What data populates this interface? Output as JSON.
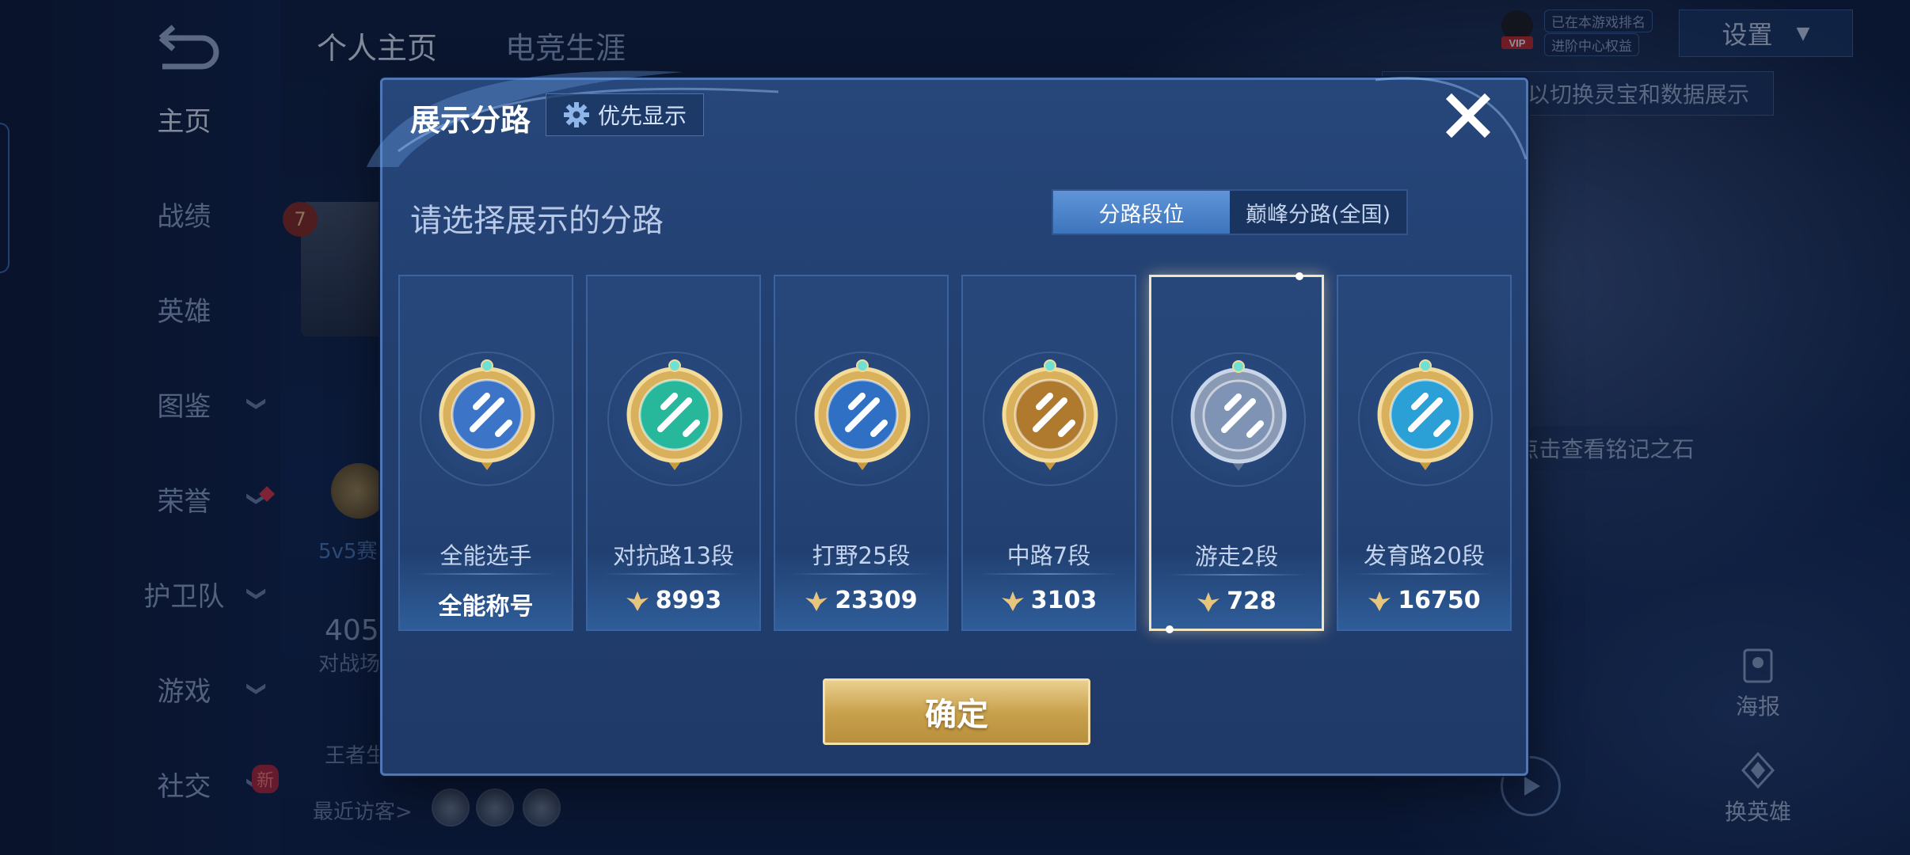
{
  "background": {
    "top_tabs": [
      "个人主页",
      "电竞生涯"
    ],
    "nav_items": [
      {
        "label": "主页",
        "has_chevron": false,
        "active": true
      },
      {
        "label": "战绩",
        "has_chevron": false,
        "active": false
      },
      {
        "label": "英雄",
        "has_chevron": false,
        "active": false
      },
      {
        "label": "图鉴",
        "has_chevron": true,
        "active": false
      },
      {
        "label": "荣誉",
        "has_chevron": true,
        "active": false
      },
      {
        "label": "护卫队",
        "has_chevron": true,
        "active": false
      },
      {
        "label": "游戏",
        "has_chevron": true,
        "active": false
      },
      {
        "label": "社交",
        "has_chevron": true,
        "active": false
      }
    ],
    "new_badge": "新",
    "vip_label": "VIP",
    "vip_tags": [
      "已在本游戏排名",
      "进阶中心权益"
    ],
    "settings_label": "设置",
    "hint_text": "以切换灵宝和数据展示",
    "hint_text_2": "点击查看铭记之石",
    "mode_text": "5v5赛",
    "battle_number": "405",
    "battle_label": "对战场",
    "king_label": "王者生",
    "recent_visitors_label": "最近访客>",
    "rank_badge_number": "7",
    "tool_poster": "海报",
    "tool_switch_hero": "换英雄"
  },
  "modal": {
    "title": "展示分路",
    "priority_button": "优先显示",
    "prompt": "请选择展示的分路",
    "toggle": {
      "options": [
        "分路段位",
        "巅峰分路(全国)"
      ],
      "selected_index": 0
    },
    "lanes": [
      {
        "name": "全能选手",
        "score": "全能称号",
        "has_wing_icon": false,
        "selected": false,
        "emblem": "allround-emblem",
        "emblem_color": "#3c74c8"
      },
      {
        "name": "对抗路13段",
        "score": "8993",
        "has_wing_icon": true,
        "selected": false,
        "emblem": "clash-lane-emblem",
        "emblem_color": "#27b79a"
      },
      {
        "name": "打野25段",
        "score": "23309",
        "has_wing_icon": true,
        "selected": false,
        "emblem": "jungle-emblem",
        "emblem_color": "#2f6fc4"
      },
      {
        "name": "中路7段",
        "score": "3103",
        "has_wing_icon": true,
        "selected": false,
        "emblem": "mid-lane-emblem",
        "emblem_color": "#b07a2e"
      },
      {
        "name": "游走2段",
        "score": "728",
        "has_wing_icon": true,
        "selected": true,
        "emblem": "roam-emblem",
        "emblem_color": "#7f93b4"
      },
      {
        "name": "发育路20段",
        "score": "16750",
        "has_wing_icon": true,
        "selected": false,
        "emblem": "farm-lane-emblem",
        "emblem_color": "#2aa0d6"
      }
    ],
    "confirm_button": "确定"
  },
  "colors": {
    "gold": "#c9a24e",
    "toggle_active": "#4a82c9",
    "modal_bg": "#24427a"
  }
}
